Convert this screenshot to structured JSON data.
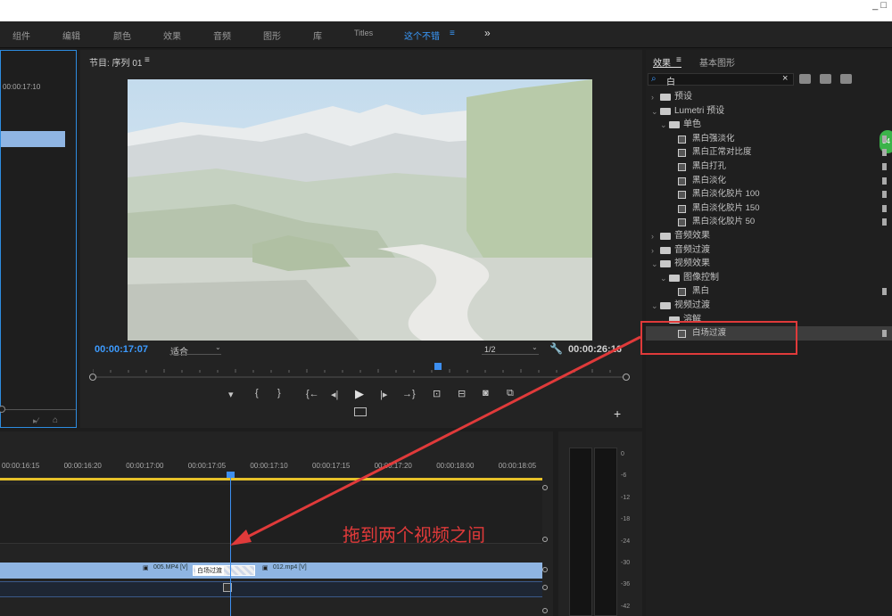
{
  "menubar": {
    "items": [
      "组件",
      "编辑",
      "颜色",
      "效果",
      "音频",
      "图形",
      "库",
      "Titles",
      "这个不错",
      "≡",
      "»"
    ]
  },
  "source": {
    "timecode": "00:00:17:10"
  },
  "program": {
    "title": "节目: 序列 01",
    "menu": "≡",
    "timecode_current": "00:00:17:07",
    "fit": "适合",
    "resolution": "1/2",
    "timecode_total": "00:00:26:16"
  },
  "effects": {
    "tab_effects": "效果",
    "tab_menu": "≡",
    "tab_graphics": "基本图形",
    "search_value": "白",
    "badge": "34",
    "tree": [
      {
        "label": "预设",
        "level": 0,
        "kind": "folder-preset",
        "open": false
      },
      {
        "label": "Lumetri 预设",
        "level": 0,
        "kind": "folder-preset",
        "open": true
      },
      {
        "label": "单色",
        "level": 1,
        "kind": "folder-preset",
        "open": true
      },
      {
        "label": "黑白强淡化",
        "level": 2,
        "kind": "preset"
      },
      {
        "label": "黑白正常对比度",
        "level": 2,
        "kind": "preset"
      },
      {
        "label": "黑白打孔",
        "level": 2,
        "kind": "preset"
      },
      {
        "label": "黑白淡化",
        "level": 2,
        "kind": "preset"
      },
      {
        "label": "黑白淡化胶片 100",
        "level": 2,
        "kind": "preset"
      },
      {
        "label": "黑白淡化胶片 150",
        "level": 2,
        "kind": "preset"
      },
      {
        "label": "黑白淡化胶片 50",
        "level": 2,
        "kind": "preset"
      },
      {
        "label": "音频效果",
        "level": 0,
        "kind": "folder",
        "open": false
      },
      {
        "label": "音频过渡",
        "level": 0,
        "kind": "folder",
        "open": false
      },
      {
        "label": "视频效果",
        "level": 0,
        "kind": "folder",
        "open": true
      },
      {
        "label": "图像控制",
        "level": 1,
        "kind": "folder",
        "open": true
      },
      {
        "label": "黑白",
        "level": 2,
        "kind": "effect"
      },
      {
        "label": "视频过渡",
        "level": 0,
        "kind": "folder",
        "open": true
      },
      {
        "label": "溶解",
        "level": 1,
        "kind": "folder",
        "open": true
      },
      {
        "label": "白场过渡",
        "level": 2,
        "kind": "transition",
        "selected": true
      }
    ]
  },
  "timeline": {
    "ruler": [
      "00:00:16:15",
      "00:00:16:20",
      "00:00:17:00",
      "00:00:17:05",
      "00:00:17:10",
      "00:00:17:15",
      "00:00:17:20",
      "00:00:18:00",
      "00:00:18:05"
    ],
    "clip_a": "005.MP4 [V]",
    "clip_b": "012.mp4 [V]",
    "transition": "白场过渡"
  },
  "annotation": {
    "text": "拖到两个视频之间",
    "color": "#e03a3a"
  },
  "meter": {
    "labels": [
      "0",
      "-6",
      "-12",
      "-18",
      "-24",
      "-30",
      "-36",
      "-42"
    ]
  }
}
